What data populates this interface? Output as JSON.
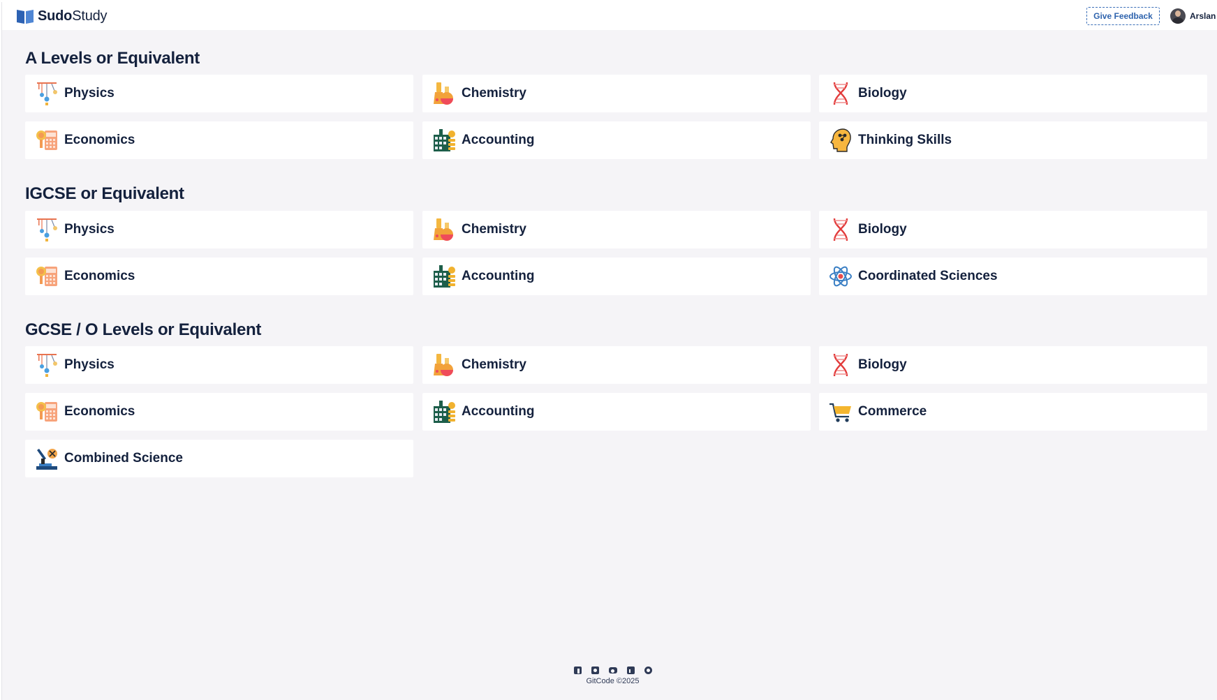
{
  "header": {
    "brand_bold": "Sudo",
    "brand_rest": "Study",
    "feedback_label": "Give Feedback",
    "user_name": "Arslan"
  },
  "sections": [
    {
      "title": "A Levels or Equivalent",
      "subjects": [
        {
          "label": "Physics",
          "icon": "physics-pendulum-icon"
        },
        {
          "label": "Chemistry",
          "icon": "chemistry-flask-icon"
        },
        {
          "label": "Biology",
          "icon": "dna-icon"
        },
        {
          "label": "Economics",
          "icon": "economics-calculator-icon"
        },
        {
          "label": "Accounting",
          "icon": "accounting-ledger-icon"
        },
        {
          "label": "Thinking Skills",
          "icon": "brain-head-icon"
        }
      ]
    },
    {
      "title": "IGCSE or Equivalent",
      "subjects": [
        {
          "label": "Physics",
          "icon": "physics-pendulum-icon"
        },
        {
          "label": "Chemistry",
          "icon": "chemistry-flask-icon"
        },
        {
          "label": "Biology",
          "icon": "dna-icon"
        },
        {
          "label": "Economics",
          "icon": "economics-calculator-icon"
        },
        {
          "label": "Accounting",
          "icon": "accounting-ledger-icon"
        },
        {
          "label": "Coordinated Sciences",
          "icon": "atom-icon"
        }
      ]
    },
    {
      "title": "GCSE / O Levels or Equivalent",
      "subjects": [
        {
          "label": "Physics",
          "icon": "physics-pendulum-icon"
        },
        {
          "label": "Chemistry",
          "icon": "chemistry-flask-icon"
        },
        {
          "label": "Biology",
          "icon": "dna-icon"
        },
        {
          "label": "Economics",
          "icon": "economics-calculator-icon"
        },
        {
          "label": "Accounting",
          "icon": "accounting-ledger-icon"
        },
        {
          "label": "Commerce",
          "icon": "shopping-cart-icon"
        },
        {
          "label": "Combined Science",
          "icon": "microscope-icon"
        }
      ]
    }
  ],
  "footer": {
    "social_icons": [
      "facebook-icon",
      "instagram-icon",
      "youtube-icon",
      "linkedin-icon",
      "reddit-icon"
    ],
    "copyright": "GitCode ©2025"
  },
  "colors": {
    "background": "#f5f4f7",
    "card": "#ffffff",
    "text": "#14213d",
    "accent": "#2e63ad"
  }
}
